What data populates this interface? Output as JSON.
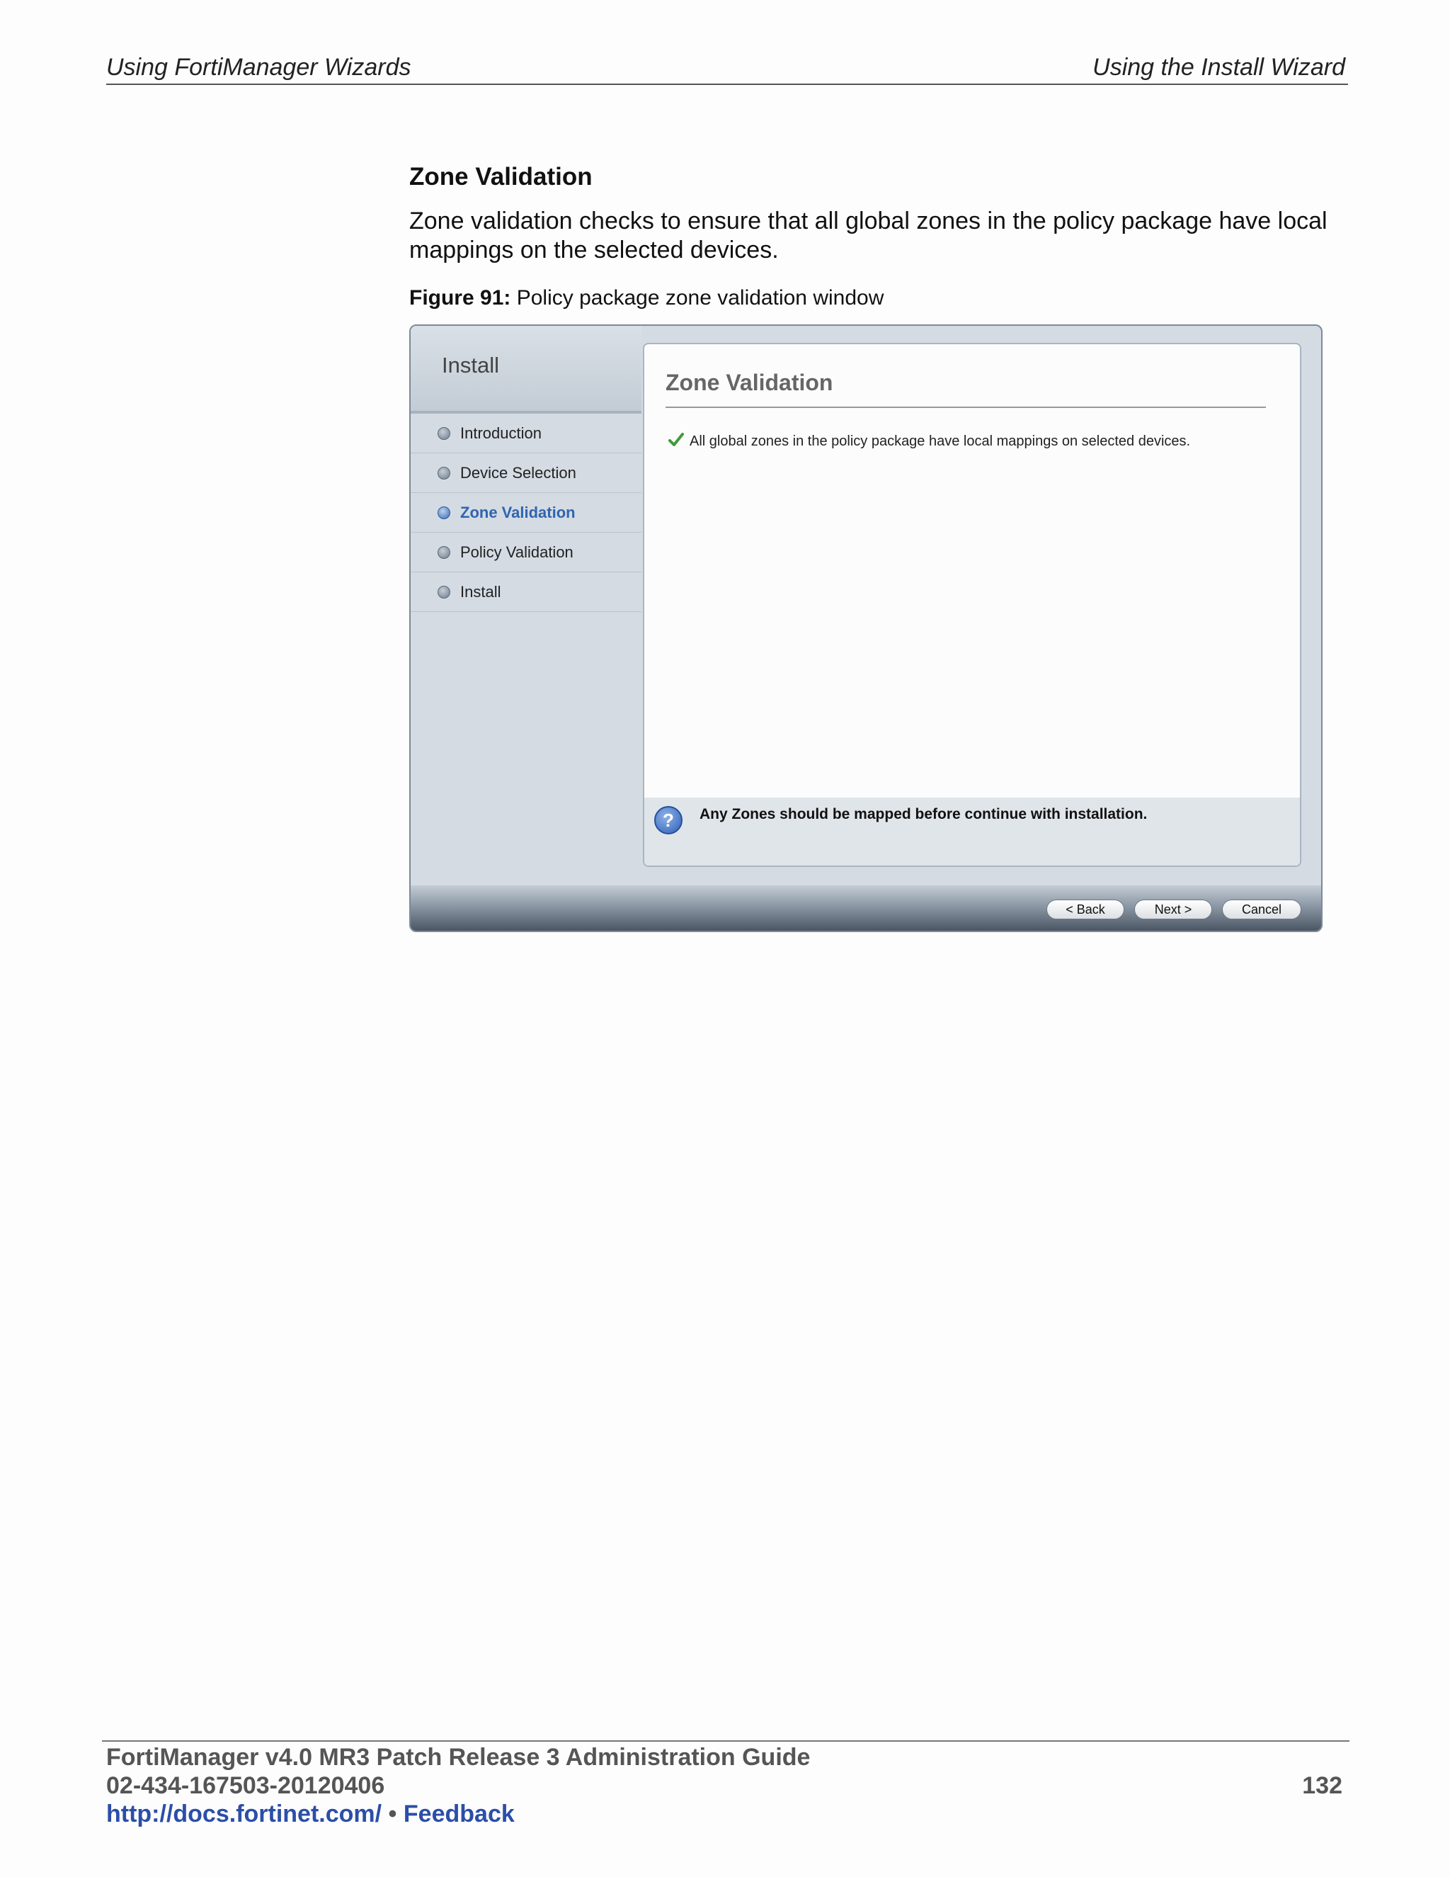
{
  "header": {
    "left": "Using FortiManager Wizards",
    "right": "Using the Install Wizard"
  },
  "section": {
    "title": "Zone Validation",
    "body": "Zone validation checks to ensure that all global zones in the policy package have local mappings on the selected devices."
  },
  "figure": {
    "label": "Figure 91:",
    "caption": "Policy package zone validation window"
  },
  "wizard": {
    "side_title": "Install",
    "steps": [
      {
        "label": "Introduction"
      },
      {
        "label": "Device Selection"
      },
      {
        "label": "Zone Validation"
      },
      {
        "label": "Policy Validation"
      },
      {
        "label": "Install"
      }
    ],
    "active_step": "Zone Validation",
    "content_title": "Zone Validation",
    "status_message": "All global zones in the policy package have local mappings on selected devices.",
    "note": "Any Zones should be mapped before continue with installation.",
    "buttons": {
      "back": "< Back",
      "next": "Next >",
      "cancel": "Cancel"
    }
  },
  "footer": {
    "guide_title": "FortiManager v4.0 MR3 Patch Release 3 Administration Guide",
    "doc_number": "02-434-167503-20120406",
    "page_number": "132",
    "docs_link": "http://docs.fortinet.com/",
    "separator": "•",
    "feedback_link": "Feedback"
  },
  "colors": {
    "link": "#2b4ea8",
    "active_step": "#2f65b0"
  }
}
